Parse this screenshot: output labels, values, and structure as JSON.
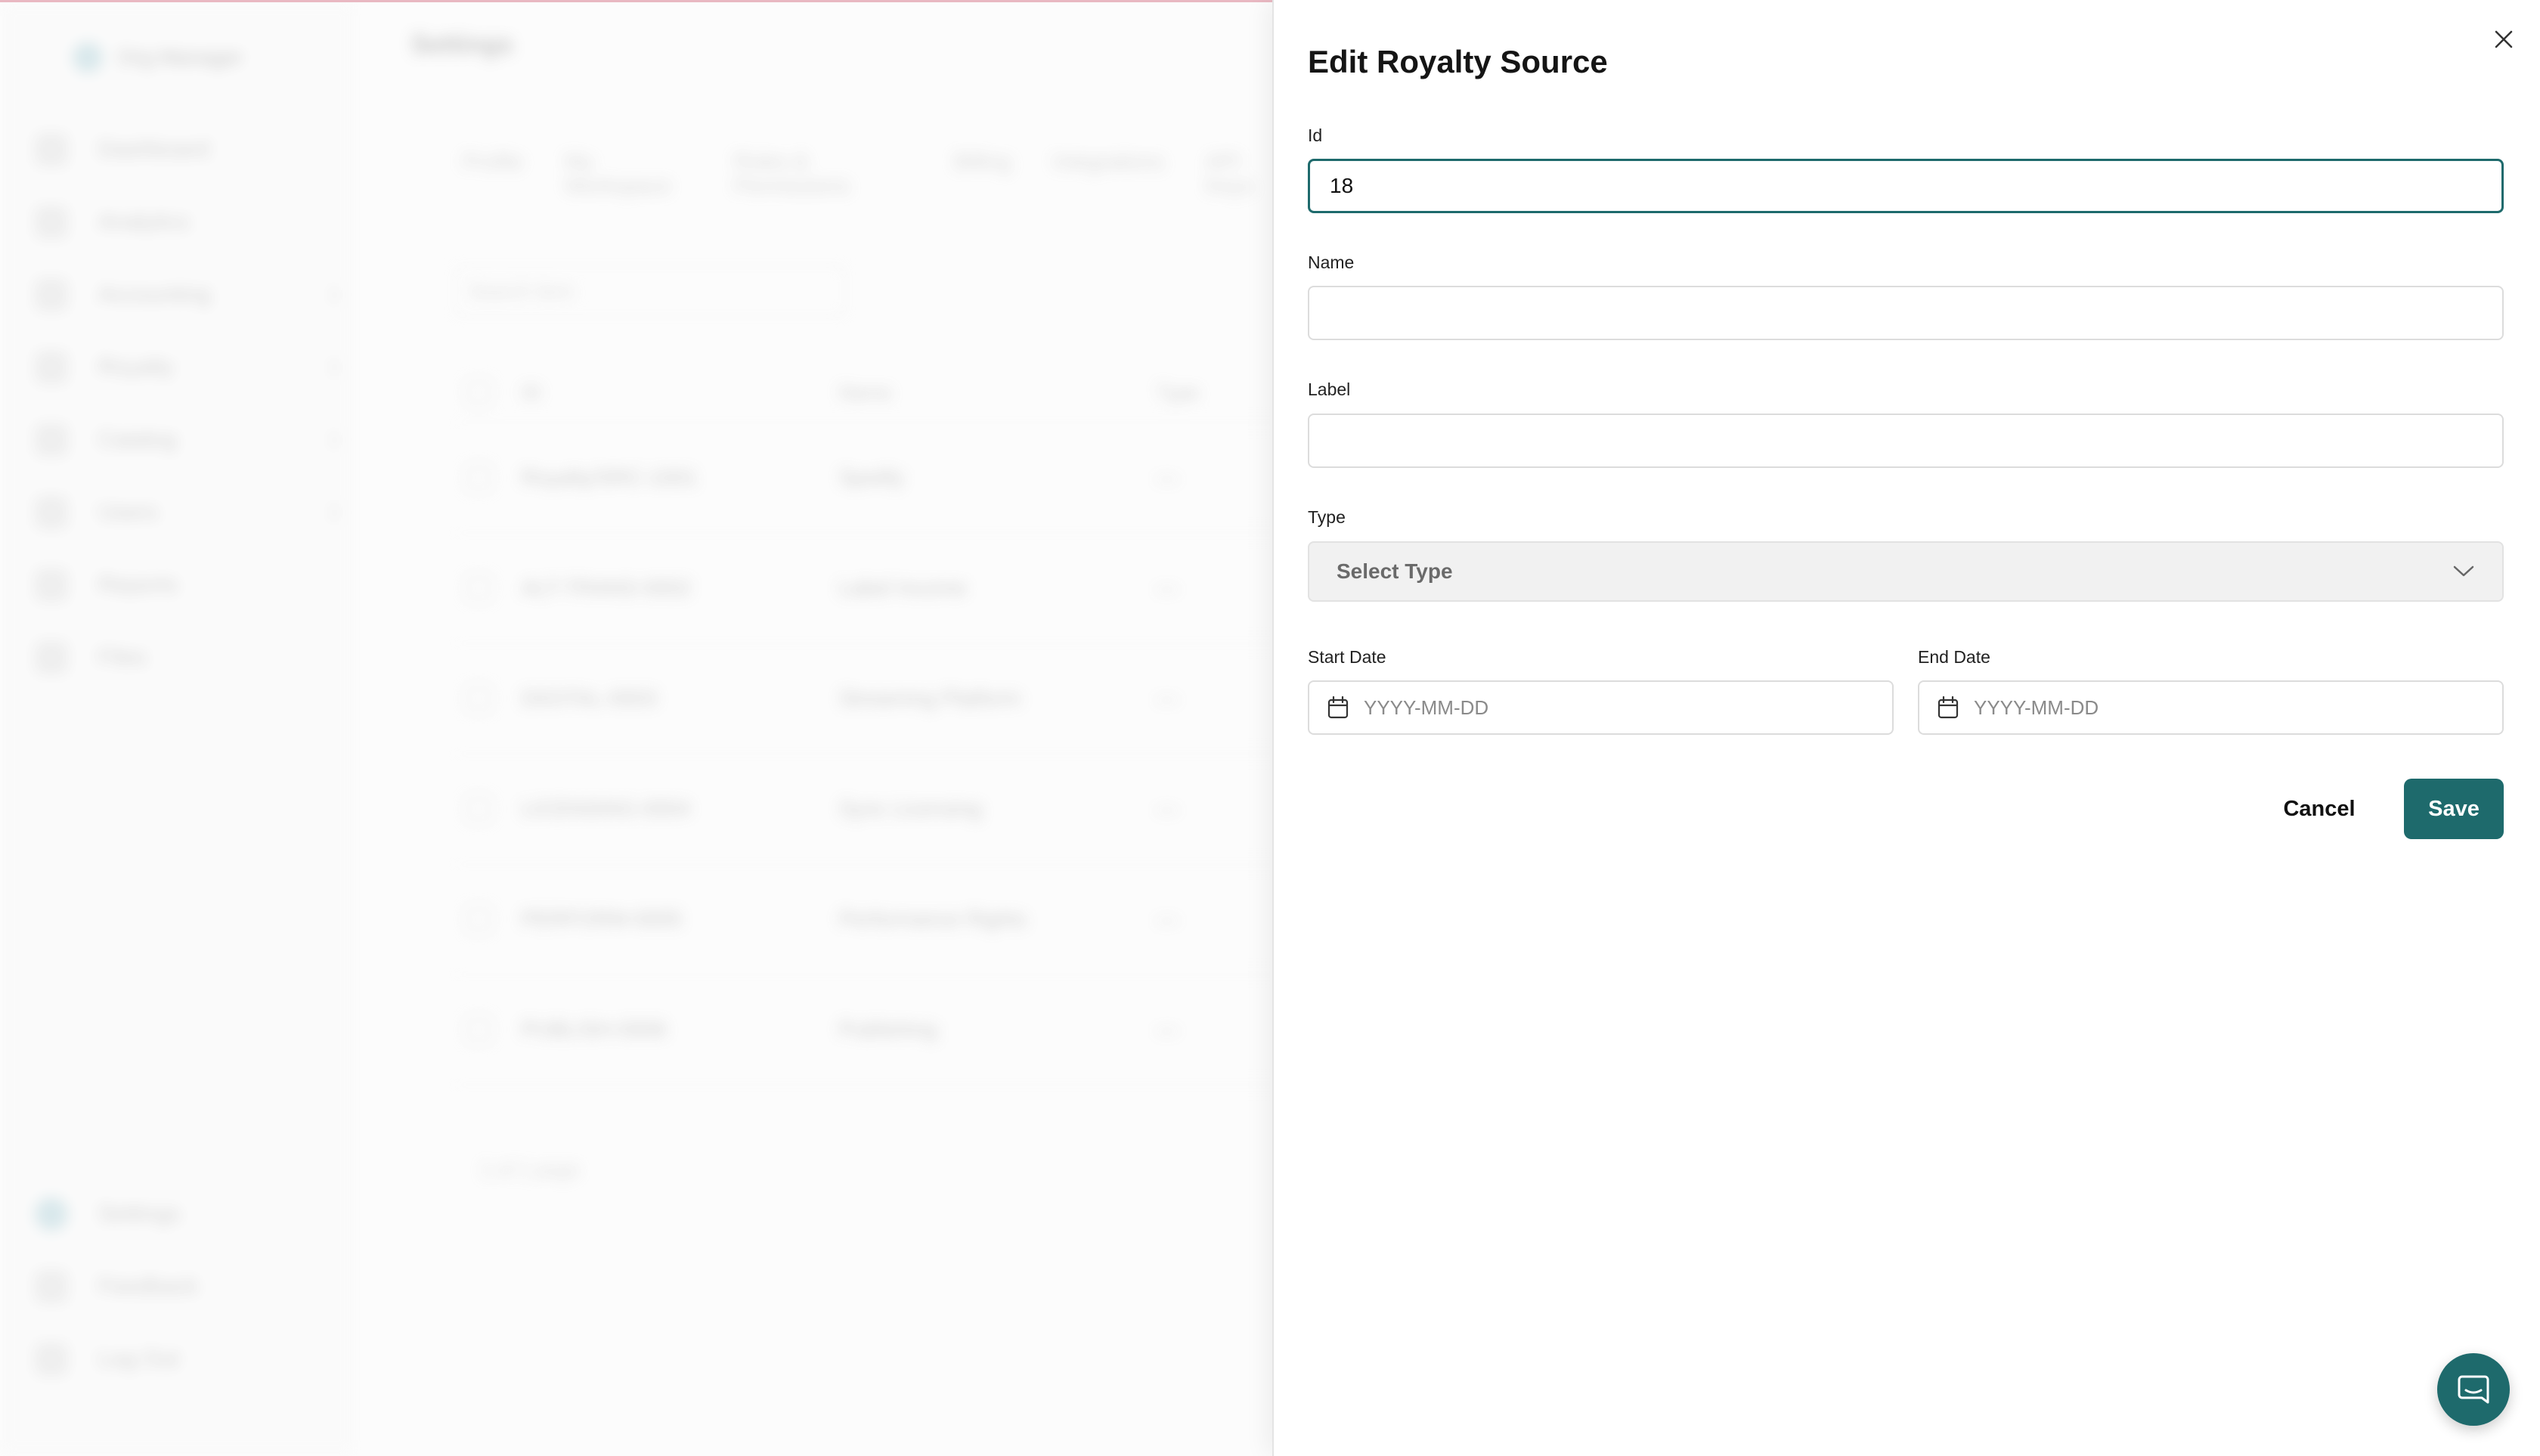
{
  "background": {
    "org_name": "Org Manager",
    "page_title": "Settings",
    "sidebar": {
      "items": [
        {
          "label": "Dashboard"
        },
        {
          "label": "Analytics"
        },
        {
          "label": "Accounting"
        },
        {
          "label": "Royalty"
        },
        {
          "label": "Catalog"
        },
        {
          "label": "Users"
        },
        {
          "label": "Reports"
        },
        {
          "label": "Files"
        }
      ],
      "bottom_items": [
        {
          "label": "Settings"
        },
        {
          "label": "Feedback"
        },
        {
          "label": "Log Out"
        }
      ]
    },
    "tabs": [
      "Profile",
      "My Workspace",
      "Roles & Permissions",
      "Billing",
      "Integrations",
      "API Keys"
    ],
    "search_placeholder": "Search item",
    "table": {
      "headers": [
        "ID",
        "Name",
        "Type"
      ],
      "rows": [
        [
          "Royalty/SRC-1001",
          "Spotify",
          "—"
        ],
        [
          "ALT-TRANS-0002",
          "Label Income",
          "—"
        ],
        [
          "DIGITAL-0003",
          "Streaming Platform",
          "—"
        ],
        [
          "LICENSING-0004",
          "Sync Licensing",
          "—"
        ],
        [
          "PERFORM-0005",
          "Performance Rights",
          "—"
        ],
        [
          "PUBLISH-0006",
          "Publishing",
          "—"
        ]
      ]
    },
    "pager": "1 of 1 page"
  },
  "drawer": {
    "title": "Edit Royalty Source",
    "fields": {
      "id": {
        "label": "Id",
        "value": "18"
      },
      "name": {
        "label": "Name",
        "value": ""
      },
      "label": {
        "label": "Label",
        "value": ""
      },
      "type": {
        "label": "Type",
        "placeholder": "Select Type"
      },
      "start_date": {
        "label": "Start Date",
        "placeholder": "YYYY-MM-DD"
      },
      "end_date": {
        "label": "End Date",
        "placeholder": "YYYY-MM-DD"
      }
    },
    "cancel_label": "Cancel",
    "save_label": "Save"
  },
  "icons": {
    "close": "close-icon",
    "chevron": "chevron-down-icon",
    "calendar": "calendar-icon",
    "chat": "chat-icon"
  },
  "colors": {
    "accent": "#1e6a6c",
    "select_bg": "#f1f1f1",
    "top_border": "#e9b8c2"
  }
}
